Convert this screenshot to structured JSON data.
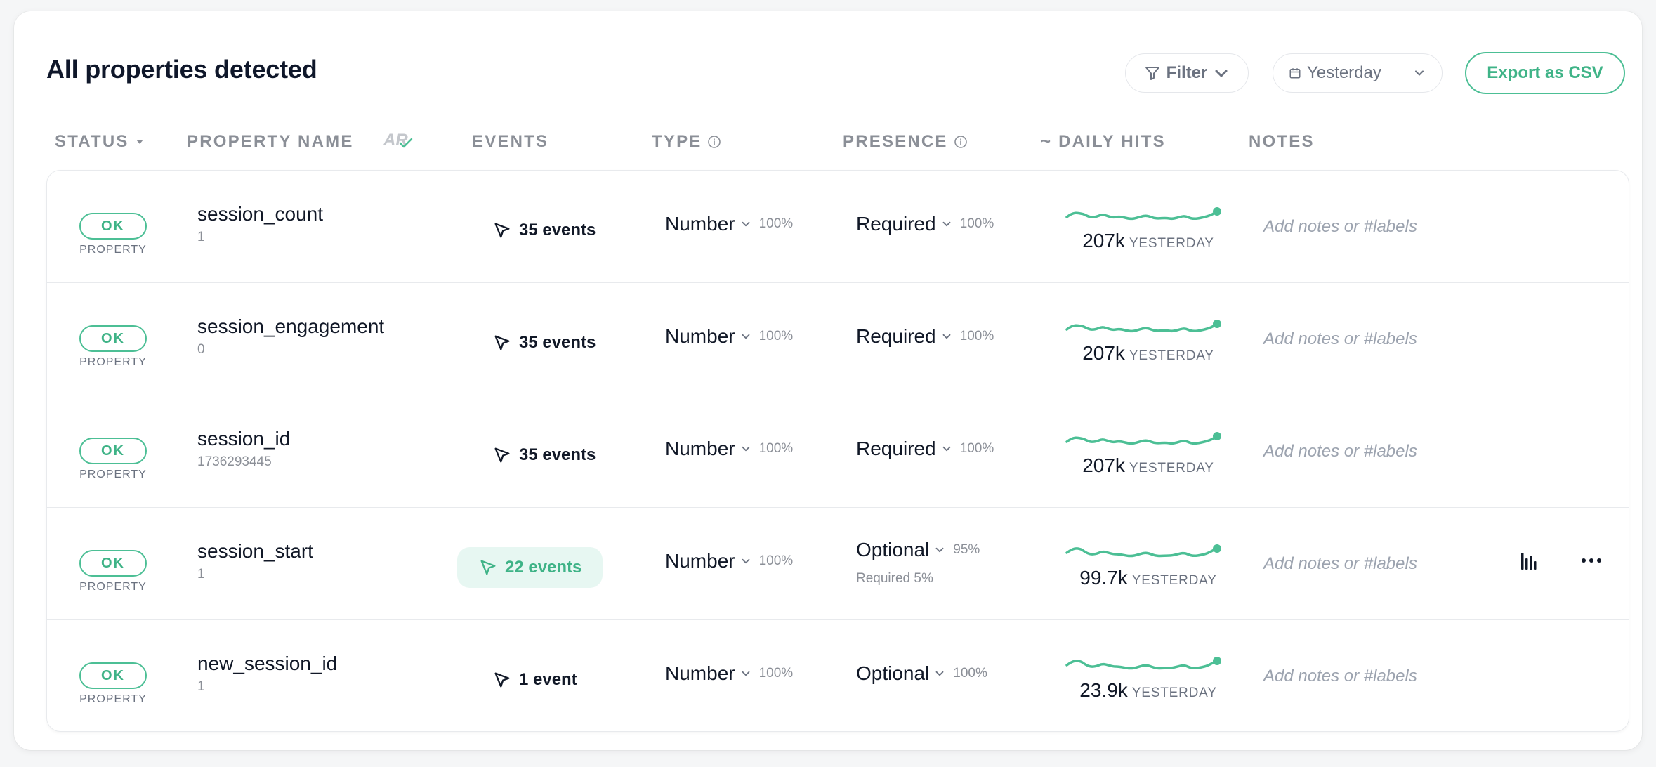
{
  "header": {
    "title": "All properties detected",
    "filter_label": "Filter",
    "date_label": "Yesterday",
    "export_label": "Export as CSV"
  },
  "columns": {
    "status": "STATUS",
    "property_name": "PROPERTY NAME",
    "ar_badge": "AR",
    "events": "EVENTS",
    "type": "TYPE",
    "presence": "PRESENCE",
    "daily_hits": "~ DAILY HITS",
    "notes": "NOTES"
  },
  "colors": {
    "accent": "#4cbf95",
    "accent_text": "#3fb387",
    "highlight_bg": "#e7f7f2",
    "muted": "#8b8f97"
  },
  "rows": [
    {
      "status": "OK",
      "status_sub": "PROPERTY",
      "name": "session_count",
      "value": "1",
      "events": "35 events",
      "type": "Number",
      "type_pct": "100%",
      "presence": "Required",
      "presence_pct": "100%",
      "presence_sub": "",
      "hits": "207k",
      "hits_unit": "YESTERDAY",
      "notes_placeholder": "Add notes or #labels"
    },
    {
      "status": "OK",
      "status_sub": "PROPERTY",
      "name": "session_engagement",
      "value": "0",
      "events": "35 events",
      "type": "Number",
      "type_pct": "100%",
      "presence": "Required",
      "presence_pct": "100%",
      "presence_sub": "",
      "hits": "207k",
      "hits_unit": "YESTERDAY",
      "notes_placeholder": "Add notes or #labels"
    },
    {
      "status": "OK",
      "status_sub": "PROPERTY",
      "name": "session_id",
      "value": "1736293445",
      "events": "35 events",
      "type": "Number",
      "type_pct": "100%",
      "presence": "Required",
      "presence_pct": "100%",
      "presence_sub": "",
      "hits": "207k",
      "hits_unit": "YESTERDAY",
      "notes_placeholder": "Add notes or #labels"
    },
    {
      "status": "OK",
      "status_sub": "PROPERTY",
      "name": "session_start",
      "value": "1",
      "events": "22 events",
      "type": "Number",
      "type_pct": "100%",
      "presence": "Optional",
      "presence_pct": "95%",
      "presence_sub": "Required 5%",
      "hits": "99.7k",
      "hits_unit": "YESTERDAY",
      "notes_placeholder": "Add notes or #labels"
    },
    {
      "status": "OK",
      "status_sub": "PROPERTY",
      "name": "new_session_id",
      "value": "1",
      "events": "1 event",
      "type": "Number",
      "type_pct": "100%",
      "presence": "Optional",
      "presence_pct": "100%",
      "presence_sub": "",
      "hits": "23.9k",
      "hits_unit": "YESTERDAY",
      "notes_placeholder": "Add notes or #labels"
    }
  ],
  "icons": {
    "filter": "filter-icon",
    "calendar": "calendar-icon",
    "chevron": "chevron-down-icon",
    "info": "info-icon",
    "cursor": "cursor-icon",
    "chart": "bar-chart-icon",
    "more": "more-icon",
    "sort": "sort-down-icon"
  }
}
